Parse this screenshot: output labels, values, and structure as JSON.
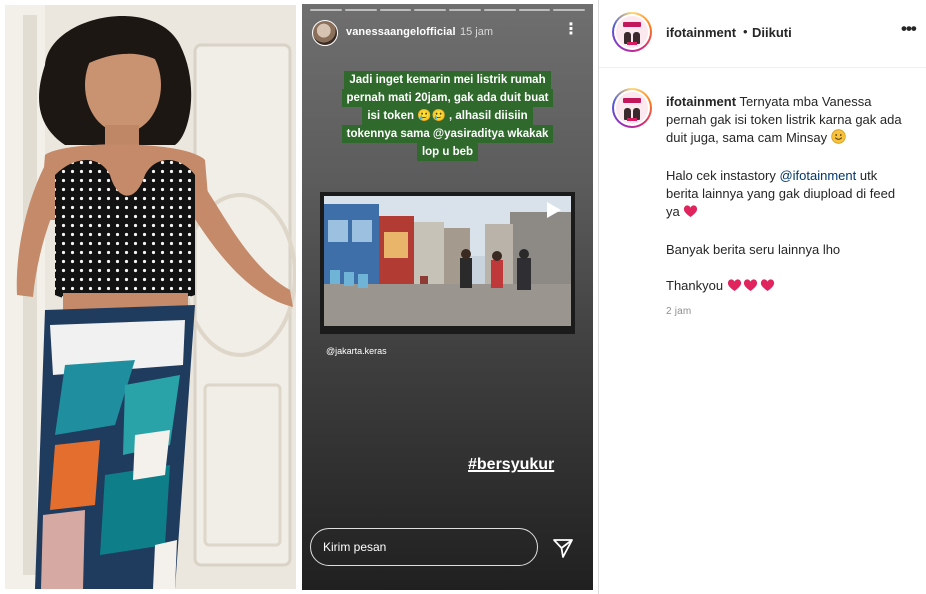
{
  "story": {
    "username": "vanessaangelofficial",
    "time": "15 jam",
    "caption_lines": [
      "Jadi inget kemarin mei listrik rumah",
      "pernah mati 20jam, gak ada duit buat",
      "isi token 🥲🥲 , alhasil diisiin",
      "tokennya sama @yasiraditya wkakak",
      "lop u beb"
    ],
    "video_credit": "@jakarta.keras",
    "hashtag": "#bersyukur",
    "reply_placeholder": "Kirim pesan"
  },
  "header": {
    "username": "ifotainment",
    "separator": "•",
    "follow_status": "Diikuti",
    "more": "•••"
  },
  "post": {
    "username": "ifotainment",
    "caption_text": "Ternyata mba Vanessa pernah gak isi token listrik karna gak ada duit juga, sama cam Minsay",
    "p2_before": "Halo cek instastory ",
    "p2_mention": "@ifotainment",
    "p2_after": " utk berita lainnya yang gak diupload di feed ya",
    "p3": "Banyak berita seru lainnya lho",
    "p4": "Thankyou",
    "time": "2 jam"
  },
  "icons": {
    "send": "send-icon",
    "heart": "red-heart-emoji",
    "smile": "smiling-emoji"
  },
  "colors": {
    "caption_bg": "#2f6a2c",
    "mention": "#00376b",
    "heart": "#e0245e",
    "muted": "#8e8e8e"
  }
}
